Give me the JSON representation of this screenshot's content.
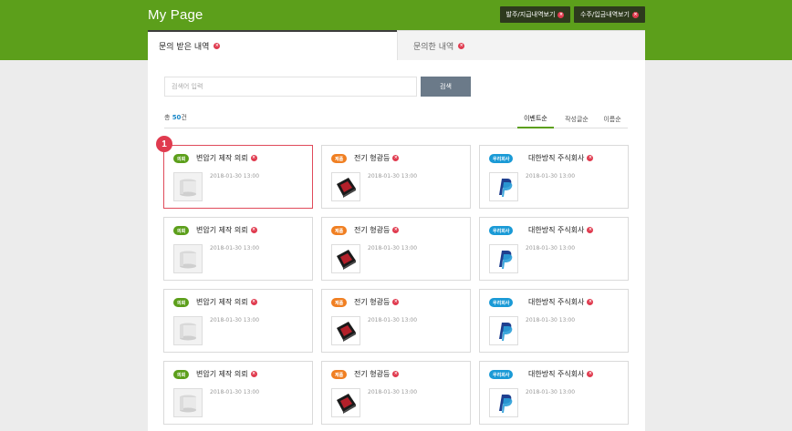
{
  "header": {
    "title": "My Page",
    "buttons": [
      {
        "label": "발주/지급내역보기",
        "icon": "close-icon"
      },
      {
        "label": "수주/입금내역보기",
        "icon": "close-icon"
      }
    ]
  },
  "tabs": [
    {
      "label": "문의 받은 내역",
      "active": true
    },
    {
      "label": "문의한 내역",
      "active": false
    }
  ],
  "search": {
    "placeholder": "검색어 입력",
    "button_label": "검색"
  },
  "count": {
    "prefix": "총",
    "value": "50",
    "suffix": "건"
  },
  "sort_options": [
    "이벤트순",
    "작성글순",
    "이름순"
  ],
  "active_sort": "이벤트순",
  "annotation_marker": "1",
  "columns": [
    {
      "badge": "의뢰",
      "badge_color": "#5c9f1b",
      "title": "변압기 제작 의뢰",
      "thumb": "transformer-thumbnail"
    },
    {
      "badge": "제품",
      "badge_color": "#f07f22",
      "title": "전기 형광등",
      "thumb": "product-thumbnail"
    },
    {
      "badge": "우리회사",
      "badge_color": "#1a9ad6",
      "title": "대한방직 주식회사",
      "thumb": "paypal-logo-thumbnail"
    }
  ],
  "cards_rows": [
    [
      "2018-01-30 13:00",
      "2018-01-30 13:00",
      "2018-01-30 13:00"
    ],
    [
      "2018-01-30 13:00",
      "2018-01-30 13:00",
      "2018-01-30 13:00"
    ],
    [
      "2018-01-30 13:00",
      "2018-01-30 13:00",
      "2018-01-30 13:00"
    ],
    [
      "2018-01-30 13:00",
      "2018-01-30 13:00",
      "2018-01-30 13:00"
    ]
  ],
  "colors": {
    "brand_green": "#5c9f1b",
    "highlight_red": "#e04a5a",
    "badge_orange": "#f07f22",
    "badge_blue": "#1a9ad6"
  }
}
